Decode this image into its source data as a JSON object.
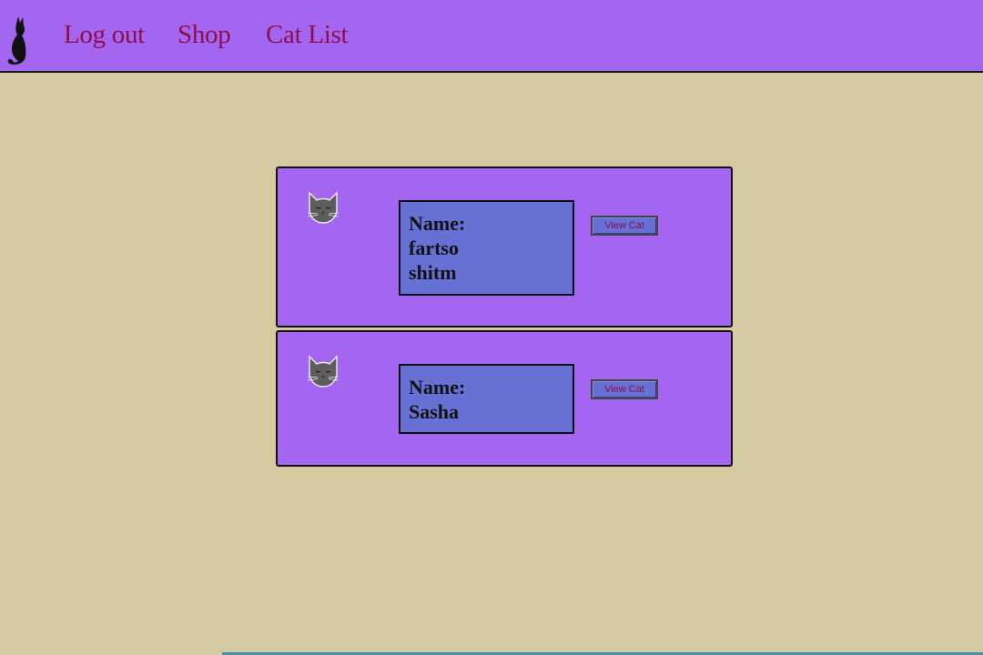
{
  "nav": {
    "logo_icon": "cat-silhouette-icon",
    "links": [
      {
        "label": "Log out"
      },
      {
        "label": "Shop"
      },
      {
        "label": "Cat List"
      }
    ]
  },
  "cats": [
    {
      "avatar_icon": "cat-face-icon",
      "name_heading": "Name:",
      "name_lines": [
        "fartso",
        "shitm"
      ],
      "button_label": "View Cat"
    },
    {
      "avatar_icon": "cat-face-icon",
      "name_heading": "Name:",
      "name_lines": [
        "Sasha"
      ],
      "button_label": "View Cat"
    }
  ],
  "colors": {
    "page_background": "#d4cba3",
    "nav_background": "#a466f0",
    "card_background": "#a466f0",
    "name_box_background": "#6670d5",
    "link_color": "#8b0f4f"
  }
}
